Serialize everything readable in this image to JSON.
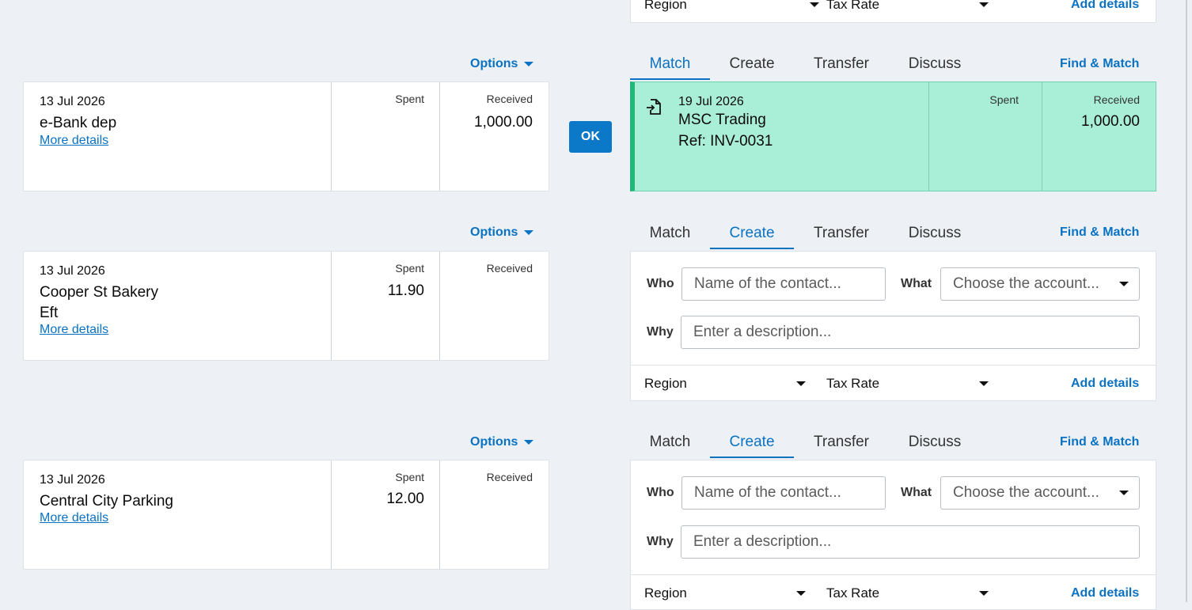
{
  "top_partial": {
    "region_label": "Region",
    "tax_rate_label": "Tax Rate",
    "add_details_label": "Add details"
  },
  "rows": [
    {
      "options_label": "Options",
      "statement": {
        "date": "13 Jul 2026",
        "payee_lines": [
          "e-Bank dep"
        ],
        "more_details_label": "More details",
        "spent_header": "Spent",
        "received_header": "Received",
        "spent": "",
        "received": "1,000.00"
      },
      "ok_label": "OK",
      "tabs": [
        "Match",
        "Create",
        "Transfer",
        "Discuss"
      ],
      "active_tab": "Match",
      "find_match_label": "Find & Match",
      "match": {
        "date": "19 Jul 2026",
        "contact": "MSC Trading",
        "reference": "Ref: INV-0031",
        "spent_header": "Spent",
        "received_header": "Received",
        "spent": "",
        "received": "1,000.00",
        "icon": "invoice-doc-icon"
      }
    },
    {
      "options_label": "Options",
      "statement": {
        "date": "13 Jul 2026",
        "payee_lines": [
          "Cooper St Bakery",
          "Eft"
        ],
        "more_details_label": "More details",
        "spent_header": "Spent",
        "received_header": "Received",
        "spent": "11.90",
        "received": ""
      },
      "tabs": [
        "Match",
        "Create",
        "Transfer",
        "Discuss"
      ],
      "active_tab": "Create",
      "find_match_label": "Find & Match",
      "create": {
        "who_label": "Who",
        "who_placeholder": "Name of the contact...",
        "what_label": "What",
        "what_placeholder": "Choose the account...",
        "why_label": "Why",
        "why_placeholder": "Enter a description...",
        "region_label": "Region",
        "tax_rate_label": "Tax Rate",
        "add_details_label": "Add details"
      }
    },
    {
      "options_label": "Options",
      "statement": {
        "date": "13 Jul 2026",
        "payee_lines": [
          "Central City Parking"
        ],
        "more_details_label": "More details",
        "spent_header": "Spent",
        "received_header": "Received",
        "spent": "12.00",
        "received": ""
      },
      "tabs": [
        "Match",
        "Create",
        "Transfer",
        "Discuss"
      ],
      "active_tab": "Create",
      "find_match_label": "Find & Match",
      "create": {
        "who_label": "Who",
        "who_placeholder": "Name of the contact...",
        "what_label": "What",
        "what_placeholder": "Choose the account...",
        "why_label": "Why",
        "why_placeholder": "Enter a description...",
        "region_label": "Region",
        "tax_rate_label": "Tax Rate",
        "add_details_label": "Add details"
      }
    }
  ],
  "colors": {
    "background": "#edf1f5",
    "accent": "#0a72c2",
    "match_fill": "#a9eed6",
    "match_edge": "#22b878",
    "ok_button": "#0b78c8"
  }
}
